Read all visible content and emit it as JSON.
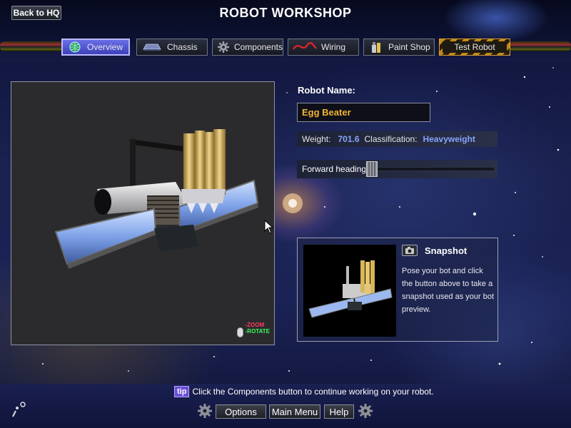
{
  "header": {
    "title": "ROBOT WORKSHOP",
    "back_label": "Back to HQ"
  },
  "tabs": [
    {
      "label": "Overview",
      "icon": "globe-icon",
      "active": true
    },
    {
      "label": "Chassis",
      "icon": "chassis-icon",
      "active": false
    },
    {
      "label": "Components",
      "icon": "gear-icon",
      "active": false
    },
    {
      "label": "Wiring",
      "icon": "wire-icon",
      "active": false
    },
    {
      "label": "Paint Shop",
      "icon": "paint-can-icon",
      "active": false
    },
    {
      "label": "Test Robot",
      "icon": "",
      "active": false
    }
  ],
  "viewport": {
    "zoom_label": "-ZOOM",
    "rotate_label": "-ROTATE"
  },
  "robot": {
    "name_label": "Robot Name:",
    "name_value": "Egg Beater",
    "weight_label": "Weight:",
    "weight_value": "701.6",
    "class_label": "Classification:",
    "class_value": "Heavyweight",
    "heading_label": "Forward heading:",
    "heading_value": 0.0
  },
  "snapshot": {
    "title": "Snapshot",
    "text": "Pose your bot and click the button above to take a snapshot used as your bot preview."
  },
  "footer": {
    "tip_badge": "tip",
    "tip_text": "Click the Components button to continue working on your robot.",
    "options_label": "Options",
    "main_menu_label": "Main Menu",
    "help_label": "Help"
  },
  "colors": {
    "accent_gold": "#f3b535",
    "value_blue": "#86a4ff",
    "active_tab": "#5a5ee0"
  }
}
